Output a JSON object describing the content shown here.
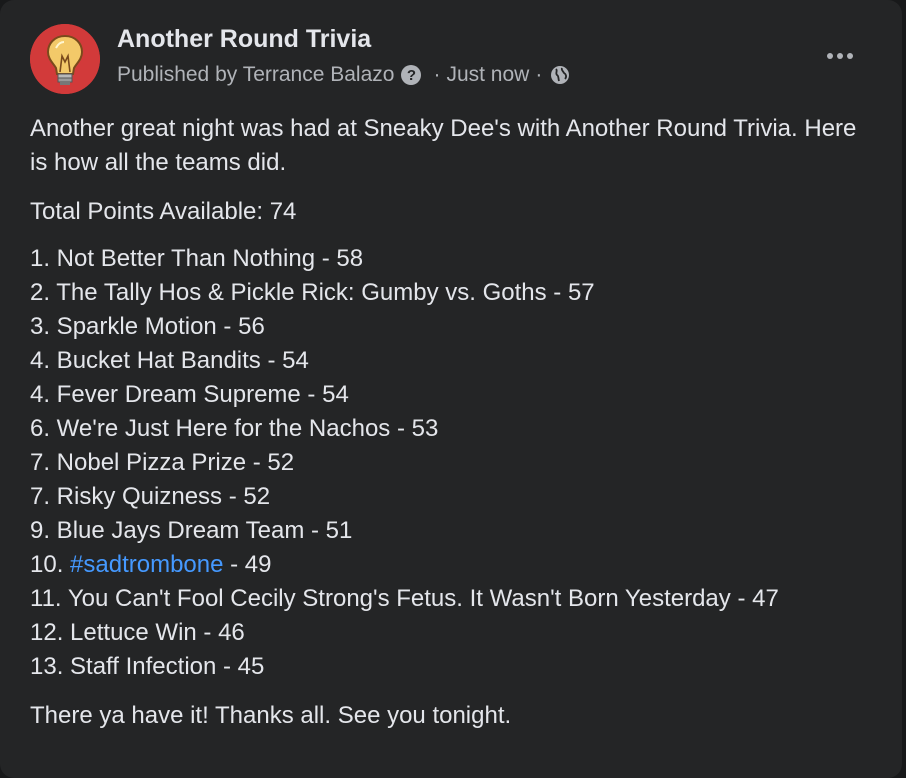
{
  "post": {
    "page_name": "Another Round Trivia",
    "published_by": "Published by Terrance Balazo",
    "help_icon": "?",
    "separator": "·",
    "timestamp": "Just now",
    "intro": "Another great night was had at Sneaky Dee's with Another Round Trivia. Here is how all the teams did.",
    "total_points": "Total Points Available: 74",
    "standings": [
      {
        "text": "1. Not Better Than Nothing - 58"
      },
      {
        "text": "2. The Tally Hos & Pickle Rick: Gumby vs.  Goths - 57"
      },
      {
        "text": "3. Sparkle Motion - 56"
      },
      {
        "text": "4. Bucket Hat Bandits - 54"
      },
      {
        "text": "4. Fever Dream Supreme - 54"
      },
      {
        "text": "6. We're Just Here for the Nachos - 53"
      },
      {
        "text": "7. Nobel Pizza Prize - 52"
      },
      {
        "text": "7. Risky Quizness - 52"
      },
      {
        "text": "9. Blue Jays Dream Team - 51"
      },
      {
        "prefix": "10. ",
        "hashtag": "#sadtrombone",
        "suffix": " - 49"
      },
      {
        "text": "11. You Can't Fool Cecily  Strong's Fetus. It Wasn't Born Yesterday - 47"
      },
      {
        "text": "12. Lettuce Win - 46"
      },
      {
        "text": "13. Staff Infection - 45"
      }
    ],
    "closing": "There ya have it! Thanks all. See you tonight."
  },
  "icons": {
    "avatar": "lightbulb-logo",
    "help": "question-circle-icon",
    "audience": "globe-icon",
    "more": "more-options-icon"
  },
  "colors": {
    "background": "#18191a",
    "card": "#242526",
    "primary_text": "#e4e6eb",
    "secondary_text": "#b0b3b8",
    "link": "#4599ff",
    "avatar_bg": "#d23a3a"
  }
}
